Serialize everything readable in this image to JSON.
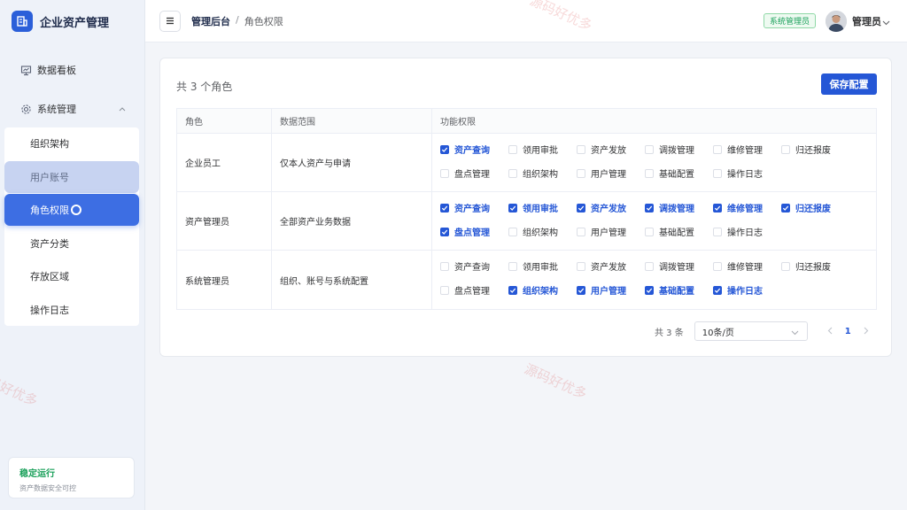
{
  "brand": {
    "title": "企业资产管理"
  },
  "sidebar": {
    "items": [
      {
        "label": "数据看板",
        "icon": "monitor-icon"
      },
      {
        "label": "系统管理",
        "icon": "gear-icon"
      }
    ],
    "submenu": [
      {
        "label": "组织架构",
        "state": "normal"
      },
      {
        "label": "用户账号",
        "state": "hover"
      },
      {
        "label": "角色权限",
        "state": "active"
      },
      {
        "label": "资产分类",
        "state": "normal"
      },
      {
        "label": "存放区域",
        "state": "normal"
      },
      {
        "label": "操作日志",
        "state": "normal"
      }
    ],
    "status": {
      "title": "稳定运行",
      "subtitle": "资产数据安全可控"
    }
  },
  "header": {
    "breadcrumb": {
      "root": "管理后台",
      "separator": "/",
      "current": "角色权限"
    },
    "role_badge": "系统管理员",
    "user_name": "管理员"
  },
  "main": {
    "count_text": "共 3 个角色",
    "save_label": "保存配置",
    "columns": [
      "角色",
      "数据范围",
      "功能权限"
    ],
    "rows": [
      {
        "role": "企业员工",
        "scope": "仅本人资产与申请",
        "perms": [
          {
            "label": "资产查询",
            "checked": true
          },
          {
            "label": "领用审批",
            "checked": false
          },
          {
            "label": "资产发放",
            "checked": false
          },
          {
            "label": "调拨管理",
            "checked": false
          },
          {
            "label": "维修管理",
            "checked": false
          },
          {
            "label": "归还报废",
            "checked": false
          },
          {
            "label": "盘点管理",
            "checked": false
          },
          {
            "label": "组织架构",
            "checked": false
          },
          {
            "label": "用户管理",
            "checked": false
          },
          {
            "label": "基础配置",
            "checked": false
          },
          {
            "label": "操作日志",
            "checked": false
          }
        ]
      },
      {
        "role": "资产管理员",
        "scope": "全部资产业务数据",
        "perms": [
          {
            "label": "资产查询",
            "checked": true
          },
          {
            "label": "领用审批",
            "checked": true
          },
          {
            "label": "资产发放",
            "checked": true
          },
          {
            "label": "调拨管理",
            "checked": true
          },
          {
            "label": "维修管理",
            "checked": true
          },
          {
            "label": "归还报废",
            "checked": true
          },
          {
            "label": "盘点管理",
            "checked": true
          },
          {
            "label": "组织架构",
            "checked": false
          },
          {
            "label": "用户管理",
            "checked": false
          },
          {
            "label": "基础配置",
            "checked": false
          },
          {
            "label": "操作日志",
            "checked": false
          }
        ]
      },
      {
        "role": "系统管理员",
        "scope": "组织、账号与系统配置",
        "perms": [
          {
            "label": "资产查询",
            "checked": false
          },
          {
            "label": "领用审批",
            "checked": false
          },
          {
            "label": "资产发放",
            "checked": false
          },
          {
            "label": "调拨管理",
            "checked": false
          },
          {
            "label": "维修管理",
            "checked": false
          },
          {
            "label": "归还报废",
            "checked": false
          },
          {
            "label": "盘点管理",
            "checked": false
          },
          {
            "label": "组织架构",
            "checked": true
          },
          {
            "label": "用户管理",
            "checked": true
          },
          {
            "label": "基础配置",
            "checked": true
          },
          {
            "label": "操作日志",
            "checked": true
          }
        ]
      }
    ],
    "pagination": {
      "total_text": "共 3 条",
      "page_size": "10条/页",
      "current_page": "1"
    }
  },
  "watermark": "源码好优多",
  "colors": {
    "primary": "#2557d6",
    "success": "#1aa05a",
    "active_menu": "#3d6ee3"
  }
}
